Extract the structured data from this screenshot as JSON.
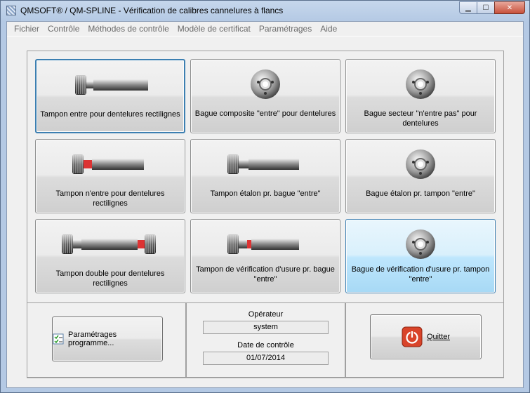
{
  "window": {
    "title": "QMSOFT® / QM-SPLINE - Vérification de calibres cannelures à flancs",
    "min_glyph": "▁",
    "max_glyph": "☐",
    "close_glyph": "✕"
  },
  "menu": [
    "Fichier",
    "Contrôle",
    "Méthodes de contrôle",
    "Modèle de certificat",
    "Paramétrages",
    "Aide"
  ],
  "tiles": [
    {
      "label": "Tampon entre pour dentelures rectilignes",
      "icon": "plug-gauge-go-icon",
      "state": "selected"
    },
    {
      "label": "Bague composite \"entre\" pour dentelures",
      "icon": "ring-gauge-icon",
      "state": "normal"
    },
    {
      "label": "Bague secteur \"n'entre pas\" pour dentelures",
      "icon": "ring-gauge-icon",
      "state": "normal"
    },
    {
      "label": "Tampon n'entre pour dentelures rectilignes",
      "icon": "plug-gauge-nogo-icon",
      "state": "normal"
    },
    {
      "label": "Tampon étalon pr. bague \"entre\"",
      "icon": "plug-gauge-go-icon",
      "state": "normal"
    },
    {
      "label": "Bague étalon pr. tampon \"entre\"",
      "icon": "ring-gauge-icon",
      "state": "normal"
    },
    {
      "label": "Tampon double pour dentelures rectilignes",
      "icon": "double-plug-gauge-icon",
      "state": "normal"
    },
    {
      "label": "Tampon de vérification d'usure pr. bague \"entre\"",
      "icon": "plug-gauge-nogo-icon",
      "state": "normal"
    },
    {
      "label": "Bague de vérification d'usure pr. tampon \"entre\"",
      "icon": "ring-gauge-icon",
      "state": "hover"
    }
  ],
  "settings_button": {
    "label": "Paramétrages programme...",
    "icon": "checklist-icon"
  },
  "operator": {
    "label": "Opérateur",
    "value": "system"
  },
  "date": {
    "label": "Date de contrôle",
    "value": "01/07/2014"
  },
  "quit_button": {
    "label": "Quitter",
    "icon": "power-icon"
  },
  "colors": {
    "accent": "#3c7fb1",
    "hover": "#bee6fd",
    "quit_icon": "#d9442a"
  }
}
